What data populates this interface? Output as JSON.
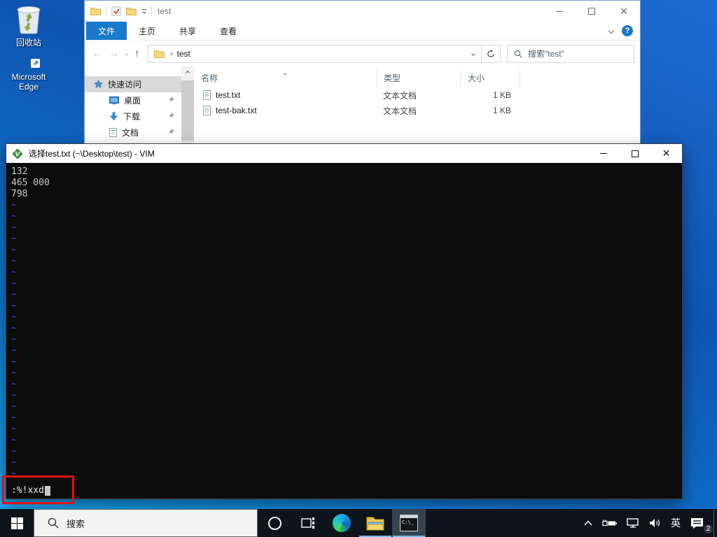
{
  "desktop": {
    "icons": [
      {
        "label": "回收站"
      },
      {
        "label": "Microsoft Edge"
      }
    ]
  },
  "explorer": {
    "window_title": "test",
    "tabs": [
      {
        "label": "文件"
      },
      {
        "label": "主页"
      },
      {
        "label": "共享"
      },
      {
        "label": "查看"
      }
    ],
    "address_path": "test",
    "search_text": "搜索\"test\"",
    "sidebar": {
      "items": [
        {
          "label": "快速访问"
        },
        {
          "label": "桌面"
        },
        {
          "label": "下载"
        },
        {
          "label": "文档"
        }
      ]
    },
    "columns": {
      "name": "名称",
      "type": "类型",
      "size": "大小"
    },
    "files": [
      {
        "name": "test.txt",
        "type": "文本文档",
        "size": "1 KB"
      },
      {
        "name": "test-bak.txt",
        "type": "文本文档",
        "size": "1 KB"
      }
    ]
  },
  "vim": {
    "title": "选择test.txt (~\\Desktop\\test) - VIM",
    "buffer_lines": [
      "132",
      "465 000",
      "798"
    ],
    "tilde_char": "~",
    "tilde_rows": 25,
    "command_line": ":%!xxd"
  },
  "taskbar": {
    "search_text": "搜索",
    "ime_label": "英",
    "notification_count": "2"
  }
}
